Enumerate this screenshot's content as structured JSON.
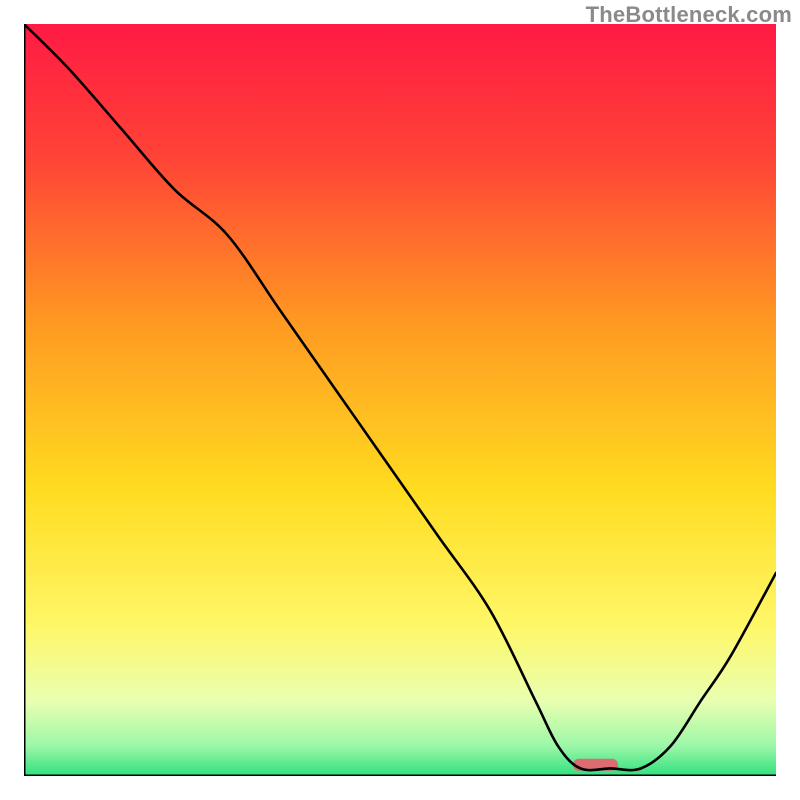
{
  "watermark": "TheBottleneck.com",
  "chart_data": {
    "type": "line",
    "title": "",
    "xlabel": "",
    "ylabel": "",
    "axes": {
      "xlim": [
        0,
        100
      ],
      "ylim": [
        0,
        100
      ],
      "ticks_visible": false,
      "left_border": true,
      "bottom_border": true,
      "top_border": false,
      "right_border": false
    },
    "background_gradient": {
      "stops": [
        {
          "offset": 0,
          "color": "#ff1a44"
        },
        {
          "offset": 0.18,
          "color": "#ff4436"
        },
        {
          "offset": 0.4,
          "color": "#ff9a22"
        },
        {
          "offset": 0.62,
          "color": "#ffdc20"
        },
        {
          "offset": 0.8,
          "color": "#fff768"
        },
        {
          "offset": 0.9,
          "color": "#e9ffb0"
        },
        {
          "offset": 0.96,
          "color": "#9cf7a8"
        },
        {
          "offset": 1.0,
          "color": "#2fe07e"
        }
      ]
    },
    "series": [
      {
        "name": "bottleneck-curve",
        "color": "#000000",
        "stroke_width": 2.6,
        "x": [
          0,
          6,
          13,
          20,
          27,
          34,
          41,
          48,
          55,
          62,
          68,
          71,
          74,
          78,
          82,
          86,
          90,
          94,
          100
        ],
        "values": [
          100,
          94,
          86,
          78,
          72,
          62,
          52,
          42,
          32,
          22,
          10,
          4,
          1,
          1,
          1,
          4,
          10,
          16,
          27
        ]
      }
    ],
    "marker": {
      "name": "optimal-range",
      "x_center": 76,
      "y": 1.5,
      "width_pct": 6,
      "height_pct": 1.6,
      "color": "#de6b70",
      "border_radius_pct": 0.8
    }
  }
}
